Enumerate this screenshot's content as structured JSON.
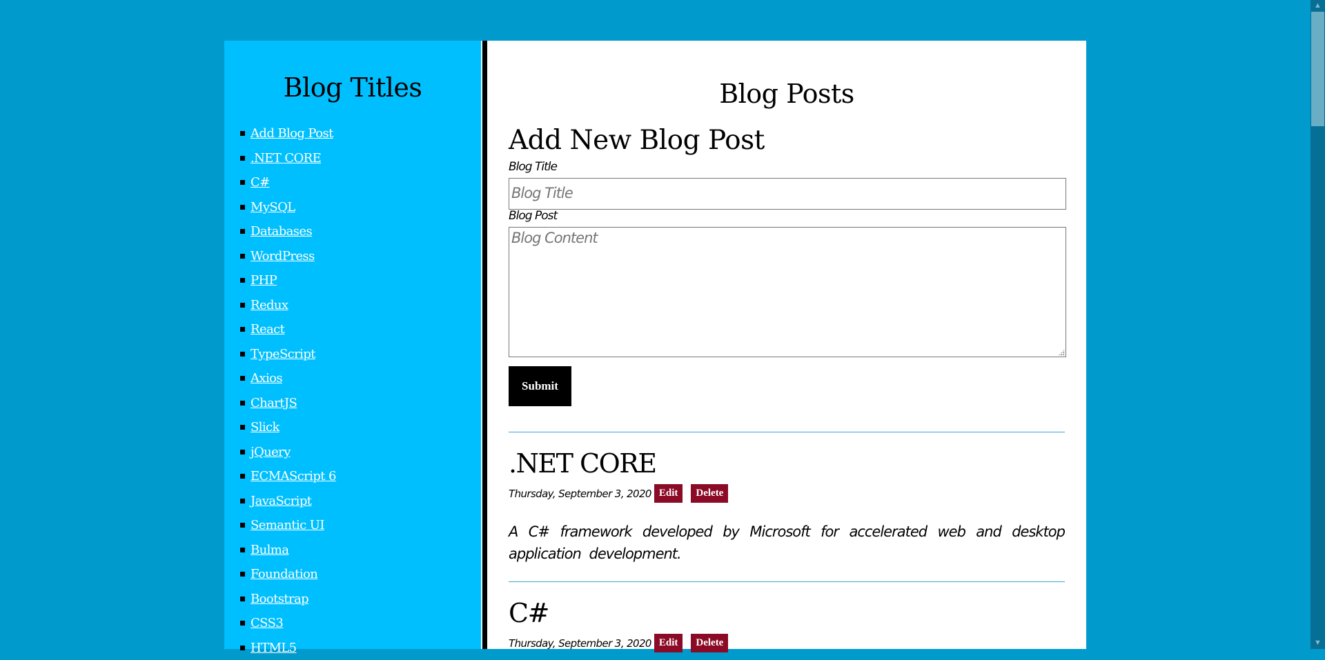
{
  "sidebar": {
    "title": "Blog Titles",
    "items": [
      {
        "label": "Add Blog Post"
      },
      {
        "label": ".NET CORE"
      },
      {
        "label": "C#"
      },
      {
        "label": "MySQL"
      },
      {
        "label": "Databases"
      },
      {
        "label": "WordPress"
      },
      {
        "label": "PHP"
      },
      {
        "label": "Redux"
      },
      {
        "label": "React"
      },
      {
        "label": "TypeScript"
      },
      {
        "label": "Axios"
      },
      {
        "label": "ChartJS"
      },
      {
        "label": "Slick"
      },
      {
        "label": "jQuery"
      },
      {
        "label": "ECMAScript 6"
      },
      {
        "label": "JavaScript"
      },
      {
        "label": "Semantic UI"
      },
      {
        "label": "Bulma"
      },
      {
        "label": "Foundation"
      },
      {
        "label": "Bootstrap"
      },
      {
        "label": "CSS3"
      },
      {
        "label": "HTML5"
      }
    ]
  },
  "main": {
    "title": "Blog Posts",
    "form": {
      "heading": "Add New Blog Post",
      "title_label": "Blog Title",
      "title_placeholder": "Blog Title",
      "title_value": "",
      "post_label": "Blog Post",
      "post_placeholder": "Blog Content",
      "post_value": "",
      "submit_label": "Submit"
    },
    "posts": [
      {
        "title": ".NET CORE",
        "date": "Thursday, September 3, 2020",
        "edit_label": "Edit",
        "delete_label": "Delete",
        "body": "A C# framework developed by Microsoft for accelerated web and desktop application development."
      },
      {
        "title": "C#",
        "date": "Thursday, September 3, 2020",
        "edit_label": "Edit",
        "delete_label": "Delete"
      }
    ]
  },
  "colors": {
    "page_background": "#009acd",
    "sidebar_background": "#00bfff",
    "main_background": "#ffffff",
    "button_dark": "#000000",
    "button_danger": "#8b0a25",
    "divider_line": "#3aa6d8"
  },
  "scrollbar": {
    "up_icon": "▲",
    "down_icon": "▼"
  }
}
